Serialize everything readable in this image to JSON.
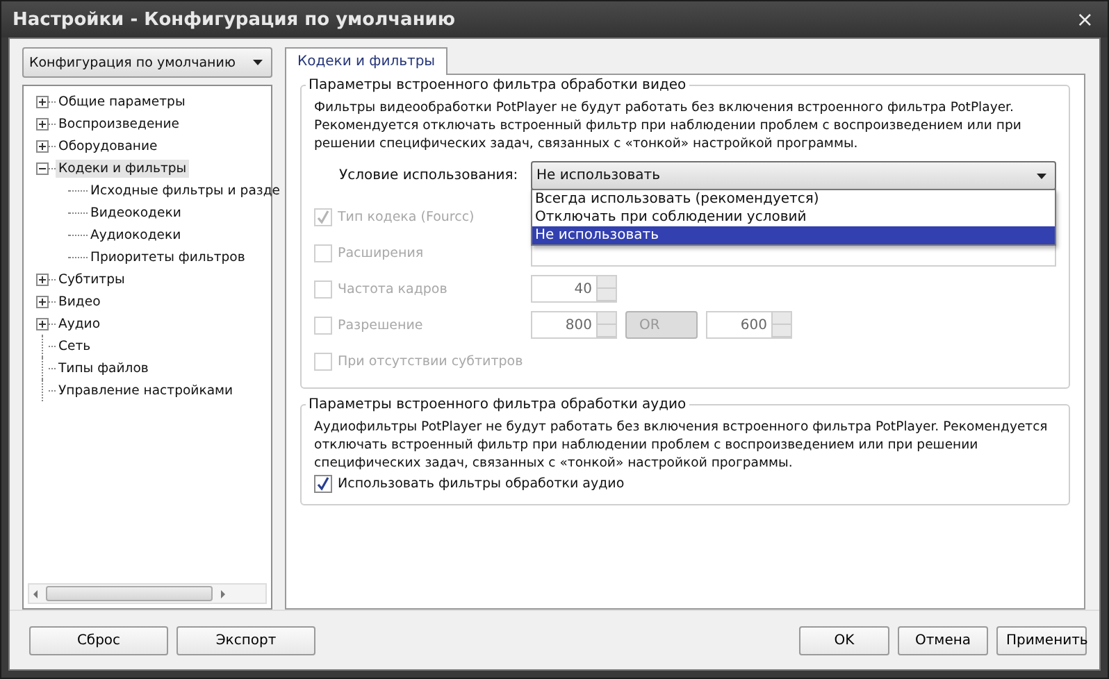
{
  "window": {
    "title": "Настройки - Конфигурация по умолчанию",
    "close": "×"
  },
  "profile": {
    "value": "Конфигурация по умолчанию"
  },
  "tree": [
    {
      "label": "Общие параметры",
      "expanded": false,
      "selected": false
    },
    {
      "label": "Воспроизведение",
      "expanded": false,
      "selected": false
    },
    {
      "label": "Оборудование",
      "expanded": false,
      "selected": false
    },
    {
      "label": "Кодеки и фильтры",
      "expanded": true,
      "selected": true,
      "children": [
        {
          "label": "Исходные фильтры и разде",
          "selected": false
        },
        {
          "label": "Видеокодеки",
          "selected": false
        },
        {
          "label": "Аудиокодеки",
          "selected": false
        },
        {
          "label": "Приоритеты фильтров",
          "selected": false
        }
      ]
    },
    {
      "label": "Субтитры",
      "expanded": false,
      "selected": false
    },
    {
      "label": "Видео",
      "expanded": false,
      "selected": false
    },
    {
      "label": "Аудио",
      "expanded": false,
      "selected": false
    },
    {
      "label": "Сеть",
      "selected": false
    },
    {
      "label": "Типы файлов",
      "selected": false
    },
    {
      "label": "Управление настройками",
      "selected": false
    }
  ],
  "tabs": [
    {
      "label": "Кодеки и фильтры",
      "selected": true
    }
  ],
  "video_group": {
    "title": "Параметры встроенного фильтра обработки видео",
    "description": "Фильтры видеообработки PotPlayer не будут работать без включения встроенного фильтра PotPlayer. Рекомендуется отключать встроенный фильтр при наблюдении проблем с воспроизведением или при решении специфических задач, связанных с «тонкой» настройкой программы.",
    "condition_label": "Условие использования:",
    "condition": {
      "value": "Не использовать",
      "open": true,
      "options": [
        {
          "label": "Всегда использовать (рекомендуется)",
          "selected": false
        },
        {
          "label": "Отключать при соблюдении условий",
          "selected": false
        },
        {
          "label": "Не использовать",
          "selected": true
        }
      ]
    },
    "rows": [
      {
        "kind": "none",
        "label": "Тип кодека (Fourcc)",
        "checked": true,
        "disabled": true
      },
      {
        "kind": "text",
        "label": "Расширения",
        "checked": false,
        "disabled": true
      },
      {
        "kind": "spin",
        "label": "Частота кадров",
        "checked": false,
        "disabled": true,
        "value": "40"
      },
      {
        "kind": "resolution",
        "label": "Разрешение",
        "checked": false,
        "disabled": true,
        "value": "800",
        "op": "OR",
        "value2": "600"
      },
      {
        "kind": "none",
        "label": "При отсутствии субтитров",
        "checked": false,
        "disabled": true
      }
    ]
  },
  "audio_group": {
    "title": "Параметры встроенного фильтра обработки аудио",
    "description": "Аудиофильтры PotPlayer не будут работать без включения встроенного фильтра PotPlayer. Рекомендуется отключать встроенный фильтр при наблюдении проблем с воспроизведением или при решении специфических задач, связанных с «тонкой» настройкой программы.",
    "checkbox": {
      "label": "Использовать фильтры обработки аудио",
      "checked": true
    }
  },
  "left_buttons": [
    "Сброс",
    "Экспорт"
  ],
  "right_buttons": [
    "OK",
    "Отмена",
    "Применить"
  ]
}
